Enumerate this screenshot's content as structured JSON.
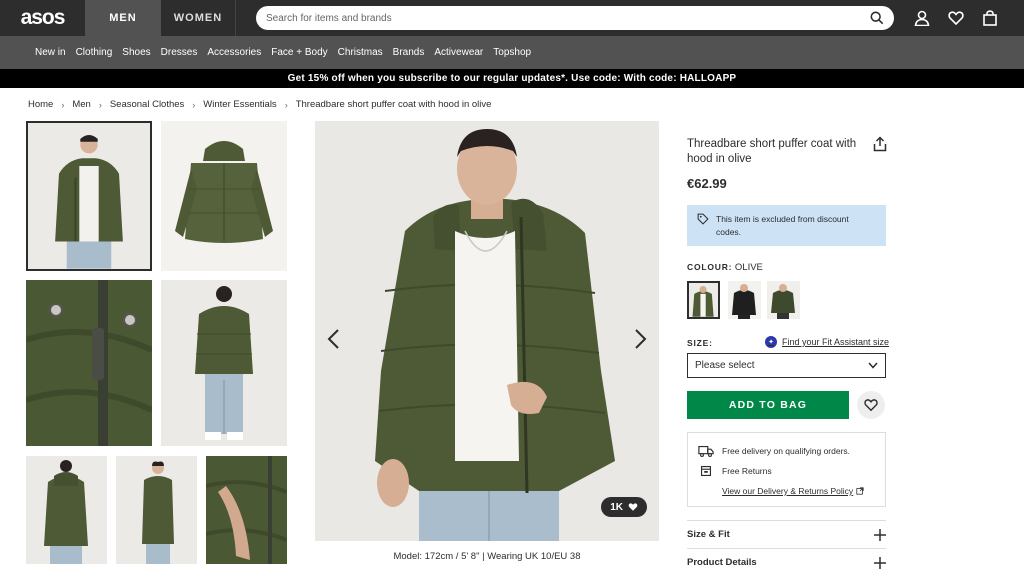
{
  "header": {
    "logo": "asos",
    "tabs": [
      "MEN",
      "WOMEN"
    ],
    "search_placeholder": "Search for items and brands",
    "icons": [
      "search-icon",
      "account-icon",
      "wishlist-icon",
      "bag-icon"
    ]
  },
  "nav": {
    "items": [
      "New in",
      "Clothing",
      "Shoes",
      "Dresses",
      "Accessories",
      "Face + Body",
      "Christmas",
      "Brands",
      "Activewear",
      "Topshop"
    ]
  },
  "promo": {
    "text": "Get 15% off when you subscribe to our regular updates*. Use code: With code: HALLOAPP"
  },
  "breadcrumb": [
    "Home",
    "Men",
    "Seasonal Clothes",
    "Winter Essentials",
    "Threadbare short puffer coat with hood in olive"
  ],
  "gallery": {
    "likes": "1K",
    "model_info": "Model: 172cm / 5' 8\" | Wearing UK 10/EU 38"
  },
  "product": {
    "title": "Threadbare short puffer coat with hood in olive",
    "price": "€62.99",
    "discount_note": "This item is excluded from discount codes.",
    "colour_label": "COLOUR:",
    "colour_value": "OLIVE",
    "size_label": "SIZE:",
    "fit_link": "Find your Fit Assistant size",
    "size_placeholder": "Please select",
    "add_to_bag": "ADD TO BAG",
    "delivery": {
      "free_delivery": "Free delivery on qualifying orders.",
      "free_returns": "Free Returns",
      "policy_link": "View our Delivery & Returns Policy"
    },
    "accordions": [
      "Size & Fit",
      "Product Details"
    ]
  },
  "colors": {
    "olive": "#4d5a35",
    "green_button": "#018849",
    "notice_blue": "#cde2f5",
    "dark": "#2d2d2d"
  }
}
